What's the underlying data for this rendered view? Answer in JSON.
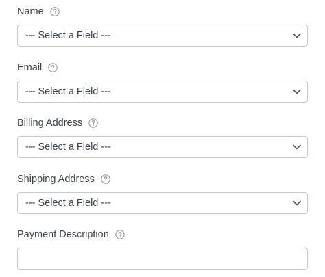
{
  "fields": [
    {
      "label": "Name",
      "type": "select",
      "value": "--- Select a Field ---"
    },
    {
      "label": "Email",
      "type": "select",
      "value": "--- Select a Field ---"
    },
    {
      "label": "Billing Address",
      "type": "select",
      "value": "--- Select a Field ---"
    },
    {
      "label": "Shipping Address",
      "type": "select",
      "value": "--- Select a Field ---"
    },
    {
      "label": "Payment Description",
      "type": "text",
      "value": "",
      "placeholder": ""
    }
  ],
  "icons": {
    "help": "question-circle-icon",
    "dropdown": "chevron-down-icon"
  },
  "colors": {
    "text": "#3c434a",
    "border": "#c6c9cc",
    "icon": "#8c8f94"
  }
}
